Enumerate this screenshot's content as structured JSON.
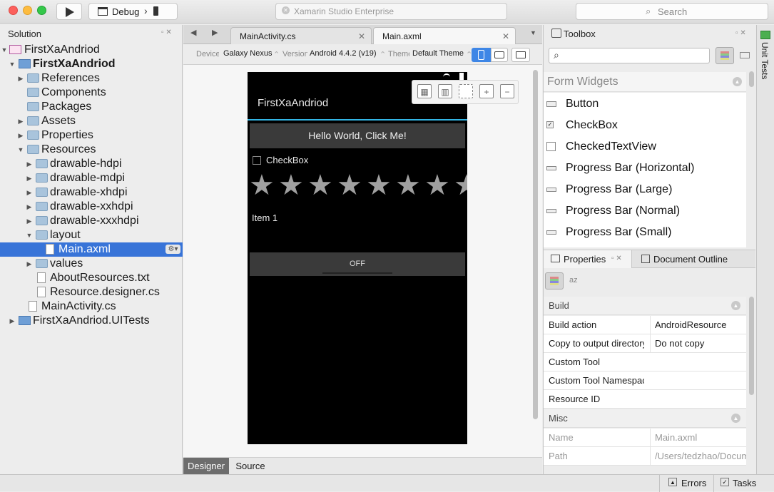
{
  "window": {
    "title": "Xamarin Studio Enterprise"
  },
  "toolbar": {
    "config": "Debug",
    "search_placeholder": "Search"
  },
  "solution": {
    "title": "Solution",
    "items": [
      {
        "label": "FirstXaAndriod"
      },
      {
        "label": "FirstXaAndriod"
      },
      {
        "label": "References"
      },
      {
        "label": "Components"
      },
      {
        "label": "Packages"
      },
      {
        "label": "Assets"
      },
      {
        "label": "Properties"
      },
      {
        "label": "Resources"
      },
      {
        "label": "drawable-hdpi"
      },
      {
        "label": "drawable-mdpi"
      },
      {
        "label": "drawable-xhdpi"
      },
      {
        "label": "drawable-xxhdpi"
      },
      {
        "label": "drawable-xxxhdpi"
      },
      {
        "label": "layout"
      },
      {
        "label": "Main.axml"
      },
      {
        "label": "values"
      },
      {
        "label": "AboutResources.txt"
      },
      {
        "label": "Resource.designer.cs"
      },
      {
        "label": "MainActivity.cs"
      },
      {
        "label": "FirstXaAndriod.UITests"
      }
    ]
  },
  "editor": {
    "tabs": [
      {
        "label": "MainActivity.cs"
      },
      {
        "label": "Main.axml"
      }
    ],
    "device_label": "Device",
    "device_value": "Galaxy Nexus",
    "version_label": "Version",
    "version_value": "Android 4.4.2 (v19)",
    "theme_label": "Theme",
    "theme_value": "Default Theme",
    "bottom_tabs": [
      "Designer",
      "Source"
    ]
  },
  "phone": {
    "app_title": "FirstXaAndriod",
    "button_text": "Hello World, Click Me!",
    "checkbox_text": "CheckBox",
    "rating_stars": 8,
    "list_item": "Item 1",
    "toggle_text": "OFF"
  },
  "toolbox": {
    "title": "Toolbox",
    "category": "Form Widgets",
    "items": [
      "Button",
      "CheckBox",
      "CheckedTextView",
      "Progress Bar (Horizontal)",
      "Progress Bar (Large)",
      "Progress Bar (Normal)",
      "Progress Bar (Small)"
    ]
  },
  "properties": {
    "tab_label": "Properties",
    "outline_label": "Document Outline",
    "build_section": "Build",
    "build": [
      {
        "name": "Build action",
        "value": "AndroidResource"
      },
      {
        "name": "Copy to output directory",
        "value": "Do not copy"
      },
      {
        "name": "Custom Tool",
        "value": ""
      },
      {
        "name": "Custom Tool Namespace",
        "value": ""
      },
      {
        "name": "Resource ID",
        "value": ""
      }
    ],
    "misc_section": "Misc",
    "misc": [
      {
        "name": "Name",
        "value": "Main.axml"
      },
      {
        "name": "Path",
        "value": "/Users/tedzhao/Documents"
      }
    ]
  },
  "right_strip": {
    "label": "Unit Tests"
  },
  "statusbar": {
    "errors": "Errors",
    "tasks": "Tasks"
  }
}
